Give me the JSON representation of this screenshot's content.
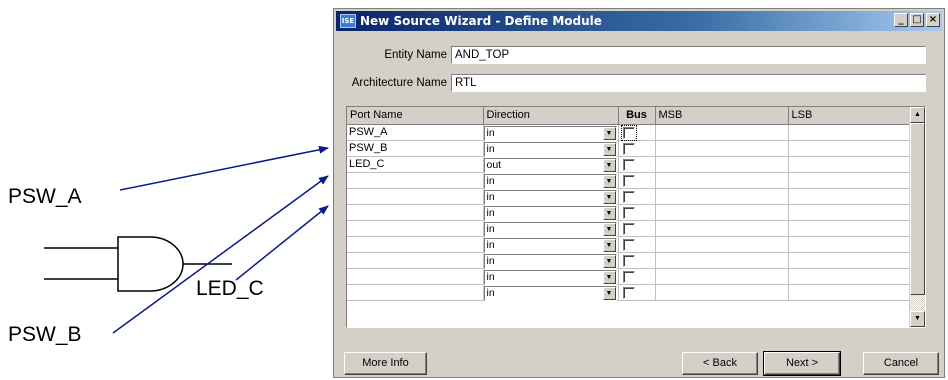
{
  "diagram": {
    "labels": {
      "psw_a": "PSW_A",
      "psw_b": "PSW_B",
      "led_c": "LED_C"
    },
    "colors": {
      "arrow": "#0a1a8a",
      "gate": "#000000"
    }
  },
  "window": {
    "title": "New Source Wizard - Define Module",
    "buttons": {
      "minimize": "_",
      "maximize": "□",
      "close": "×"
    }
  },
  "form": {
    "entity_label": "Entity Name",
    "entity_value": "AND_TOP",
    "arch_label": "Architecture Name",
    "arch_value": "RTL"
  },
  "grid": {
    "headers": {
      "port": "Port Name",
      "direction": "Direction",
      "bus": "Bus",
      "msb": "MSB",
      "lsb": "LSB"
    },
    "rows": [
      {
        "port": "PSW_A",
        "direction": "in"
      },
      {
        "port": "PSW_B",
        "direction": "in"
      },
      {
        "port": "LED_C",
        "direction": "out"
      },
      {
        "port": "",
        "direction": "in"
      },
      {
        "port": "",
        "direction": "in"
      },
      {
        "port": "",
        "direction": "in"
      },
      {
        "port": "",
        "direction": "in"
      },
      {
        "port": "",
        "direction": "in"
      },
      {
        "port": "",
        "direction": "in"
      },
      {
        "port": "",
        "direction": "in"
      },
      {
        "port": "",
        "direction": "in"
      }
    ]
  },
  "footer": {
    "more_info": "More Info",
    "back": "< Back",
    "next": "Next >",
    "cancel": "Cancel"
  }
}
